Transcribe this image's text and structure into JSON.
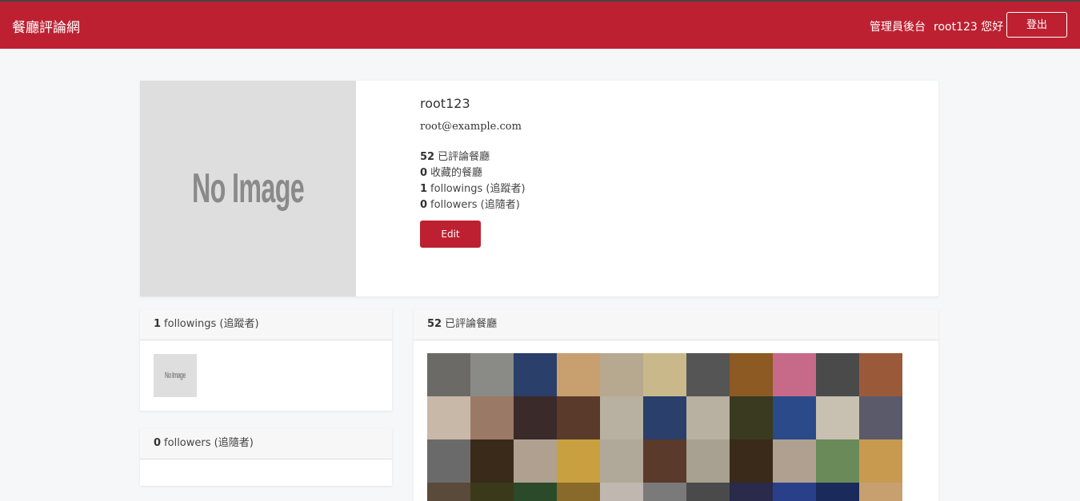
{
  "navbar": {
    "brand": "餐廳評論網",
    "admin_link": "管理員後台",
    "greeting": "root123 您好",
    "logout_label": "登出",
    "color": "#bd2131"
  },
  "profile": {
    "avatar_text": "No Image",
    "name": "root123",
    "email": "root@example.com",
    "stats": [
      {
        "count": "52",
        "label": "已評論餐廳"
      },
      {
        "count": "0",
        "label": "收藏的餐廳"
      },
      {
        "count": "1",
        "label": "followings (追蹤者)"
      },
      {
        "count": "0",
        "label": "followers (追隨者)"
      }
    ],
    "edit_label": "Edit"
  },
  "followings_panel": {
    "count": "1",
    "label": "followings (追蹤者)",
    "avatar_text": "No Image"
  },
  "followers_panel": {
    "count": "0",
    "label": "followers (追隨者)"
  },
  "comments_panel": {
    "count": "52",
    "label": "已評論餐廳",
    "thumbnail_colors": [
      "#6b6a66",
      "#8a8a86",
      "#2a3f6a",
      "#c8a070",
      "#b7a890",
      "#c9b98a",
      "#555555",
      "#8c5a22",
      "#c76a8a",
      "#4a4a4a",
      "#9a5a3a",
      "#c8b8a8",
      "#9a7a66",
      "#3a2a2a",
      "#5a3a2a",
      "#b8b0a0",
      "#2a3f6a",
      "#b8b0a0",
      "#3a3a20",
      "#2a4a8a",
      "#c8c0b0",
      "#5a5a6a",
      "#6a6a6a",
      "#3a2a1a",
      "#b0a090",
      "#c8a040",
      "#b0a898",
      "#5a3a2a",
      "#a8a090",
      "#3a2a1a",
      "#b0a090",
      "#6a8a5a",
      "#c89a50",
      "#5a4a3a",
      "#3a3a1a",
      "#2a4a2a",
      "#8a6a2a",
      "#c0b8b0",
      "#7a7a7a",
      "#4a4a4a",
      "#2a2a4a",
      "#2a3f8a",
      "#1a2a5a",
      "#c8a070"
    ]
  }
}
